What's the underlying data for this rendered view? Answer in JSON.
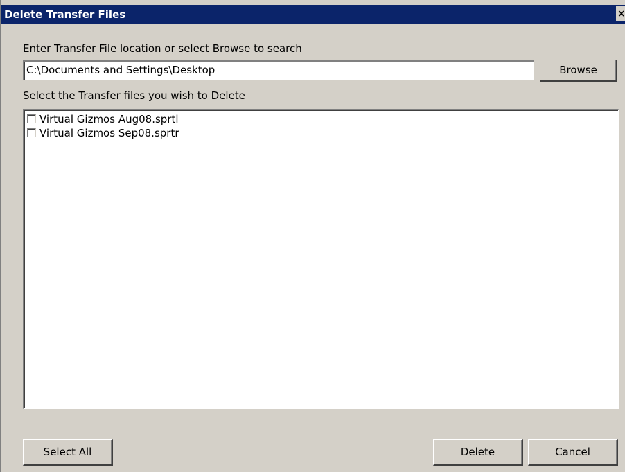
{
  "window": {
    "title": "Delete Transfer Files",
    "close_glyph": "×"
  },
  "location": {
    "label": "Enter Transfer File location or select Browse to search",
    "value": "C:\\Documents and Settings\\Desktop",
    "browse_label": "Browse"
  },
  "files": {
    "label": "Select the Transfer files you wish to Delete",
    "items": [
      {
        "name": "Virtual Gizmos Aug08.sprtl",
        "checked": false
      },
      {
        "name": "Virtual Gizmos Sep08.sprtr",
        "checked": false
      }
    ]
  },
  "buttons": {
    "select_all": "Select All",
    "delete": "Delete",
    "cancel": "Cancel"
  },
  "colors": {
    "titlebar": "#0b246a",
    "face": "#d4d0c8"
  }
}
